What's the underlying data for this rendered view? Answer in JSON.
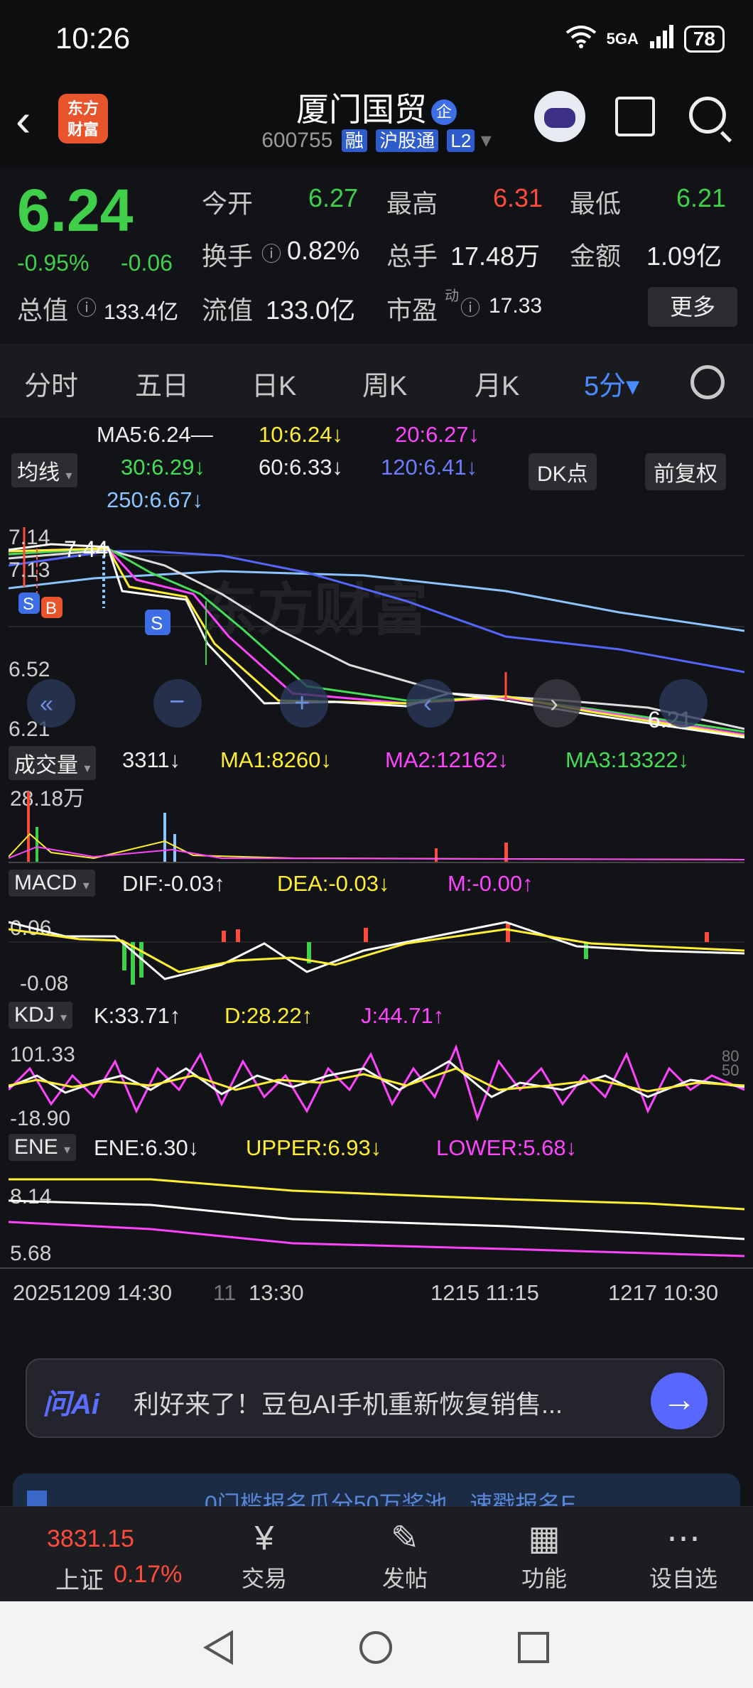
{
  "status_bar": {
    "time": "10:26",
    "network": "5GA",
    "battery": "78"
  },
  "header": {
    "logo_line1": "东方",
    "logo_line2": "财富",
    "stock_name": "厦门国贸",
    "badge": "企",
    "code": "600755",
    "tags": [
      "融",
      "沪股通",
      "L2"
    ]
  },
  "quote": {
    "price": "6.24",
    "change_pct": "-0.95%",
    "change_abs": "-0.06",
    "open_label": "今开",
    "open": "6.27",
    "high_label": "最高",
    "high": "6.31",
    "low_label": "最低",
    "low": "6.21",
    "turnover_label": "换手",
    "turnover": "0.82%",
    "volume_label": "总手",
    "volume": "17.48万",
    "amount_label": "金额",
    "amount": "1.09亿",
    "mktcap_label": "总值",
    "mktcap": "133.4亿",
    "float_label": "流值",
    "float_cap": "133.0亿",
    "pe_label": "市盈",
    "pe_sup": "动",
    "pe": "17.33",
    "more_label": "更多"
  },
  "tabs": [
    {
      "label": "分时"
    },
    {
      "label": "五日"
    },
    {
      "label": "日K"
    },
    {
      "label": "周K"
    },
    {
      "label": "月K"
    },
    {
      "label": "5分▾"
    }
  ],
  "ma_legend": {
    "selector": "均线",
    "ma5": "MA5:6.24—",
    "ma10": "10:6.24↓",
    "ma20": "20:6.27↓",
    "ma30": "30:6.29↓",
    "ma60": "60:6.33↓",
    "ma120": "120:6.41↓",
    "ma250": "250:6.67↓",
    "dk_button": "DK点",
    "adjust_button": "前复权"
  },
  "price_chart": {
    "y_top": "7.14",
    "y_mid1": "7.13",
    "y_mid2": "6.52",
    "y_bottom": "6.21",
    "high_annotation": "7.44",
    "low_annotation": "6.21",
    "marker_s": "S",
    "marker_b": "B",
    "watermark": "东方财富"
  },
  "volume_legend": {
    "selector": "成交量",
    "value": "3311↓",
    "ma1": "MA1:8260↓",
    "ma2": "MA2:12162↓",
    "ma3": "MA3:13322↓",
    "y_max": "28.18万"
  },
  "macd_legend": {
    "selector": "MACD",
    "dif": "DIF:-0.03↑",
    "dea": "DEA:-0.03↓",
    "m": "M:-0.00↑",
    "y_top": "0.06",
    "y_bottom": "-0.08"
  },
  "kdj_legend": {
    "selector": "KDJ",
    "k": "K:33.71↑",
    "d": "D:28.22↑",
    "j": "J:44.71↑",
    "y_top": "101.33",
    "y_bottom": "-18.90",
    "r80": "80",
    "r50": "50"
  },
  "ene_legend": {
    "selector": "ENE",
    "ene": "ENE:6.30↓",
    "upper": "UPPER:6.93↓",
    "lower": "LOWER:5.68↓",
    "y_top": "8.14",
    "y_bottom": "5.68"
  },
  "time_axis": {
    "t1": "20251209 14:30",
    "t2": "11",
    "t3": "13:30",
    "t4": "1215 11:15",
    "t5": "1217 10:30"
  },
  "ai_banner": {
    "logo": "问Ai",
    "text": "利好来了！豆包AI手机重新恢复销售...",
    "arrow": "→"
  },
  "promo": {
    "text": "0门槛报名瓜分50万奖池，速戳报名E"
  },
  "bottom_nav": {
    "index_value": "3831.15",
    "index_name": "上证",
    "index_change": "0.17%",
    "items": [
      {
        "label": "交易",
        "icon": "¥"
      },
      {
        "label": "发帖",
        "icon": "✎"
      },
      {
        "label": "功能",
        "icon": "▦"
      },
      {
        "label": "设自选",
        "icon": "⋯"
      }
    ]
  },
  "colors": {
    "up": "#ff4b3b",
    "down": "#3fcf4a",
    "ma5": "#eeeeee",
    "ma10": "#ffee33",
    "ma20": "#ff44ff",
    "ma30": "#44dd55",
    "ma60": "#dddddd",
    "ma120": "#5566ff",
    "ma250": "#8cc4ff"
  }
}
